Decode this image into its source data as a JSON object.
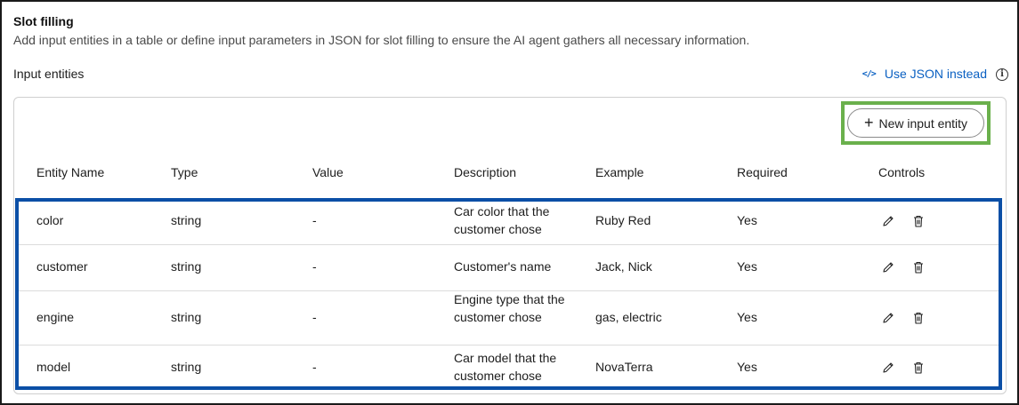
{
  "section": {
    "title": "Slot filling",
    "description": "Add input entities in a table or define input parameters in JSON for slot filling to ensure the AI agent gathers all necessary information."
  },
  "input_entities_label": "Input entities",
  "json_link": {
    "icon": "code-icon",
    "label": "Use JSON instead"
  },
  "info_icon": "i",
  "new_button": {
    "icon": "plus-icon",
    "label": "New input entity"
  },
  "table": {
    "columns": [
      "Entity Name",
      "Type",
      "Value",
      "Description",
      "Example",
      "Required",
      "Controls"
    ],
    "rows": [
      {
        "name": "color",
        "type": "string",
        "value": "-",
        "description": "Car color that the customer chose",
        "example": "Ruby Red",
        "required": "Yes"
      },
      {
        "name": "customer",
        "type": "string",
        "value": "-",
        "description": "Customer's name",
        "example": "Jack, Nick",
        "required": "Yes"
      },
      {
        "name": "engine",
        "type": "string",
        "value": "-",
        "description": "Engine type that the customer chose",
        "example": "gas, electric",
        "required": "Yes"
      },
      {
        "name": "model",
        "type": "string",
        "value": "-",
        "description": "Car model that the customer chose",
        "example": "NovaTerra",
        "required": "Yes"
      }
    ]
  },
  "colors": {
    "link": "#0a60c2",
    "highlight_green": "#6ab04c",
    "highlight_blue": "#0b4fa6"
  }
}
